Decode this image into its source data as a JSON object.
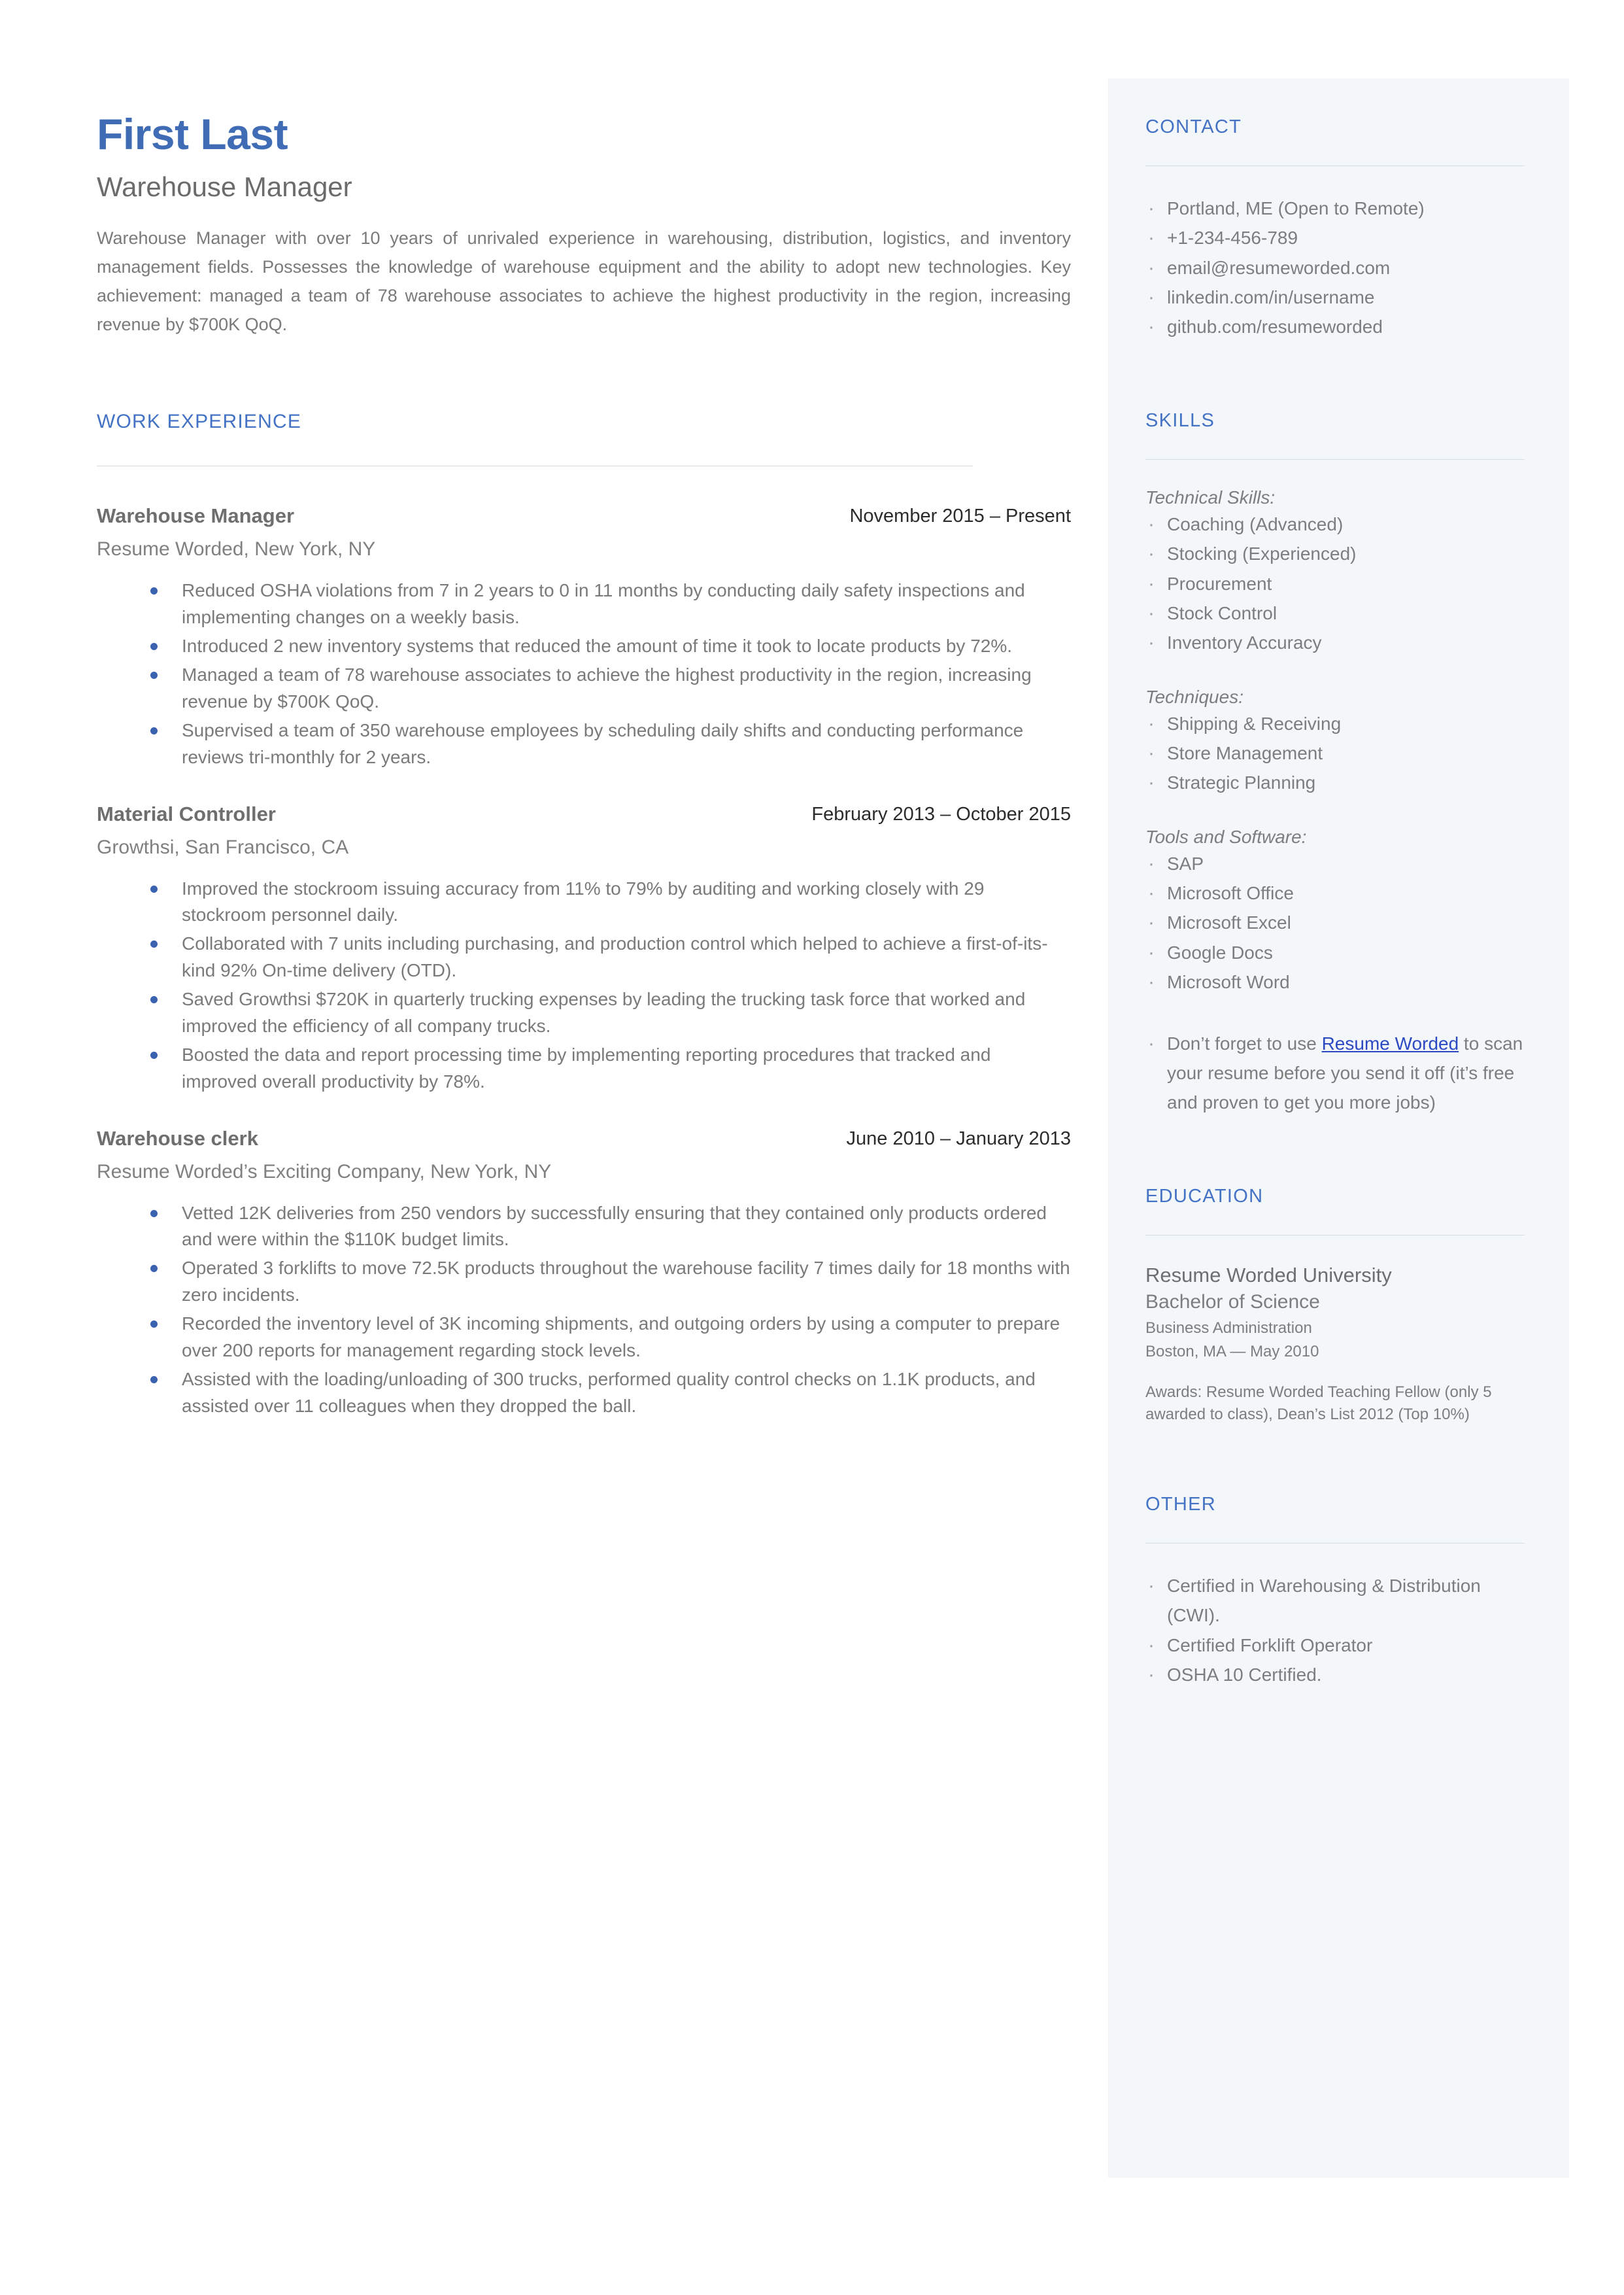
{
  "document": {
    "type": "resume",
    "accent_color": "#4472c4",
    "name_color": "#3f6cb4",
    "sidebar_background": "#f4f7fa",
    "bullet_color": "#3b62b0",
    "link_color": "#2c49c4"
  },
  "header": {
    "name": "First Last",
    "headline": "Warehouse Manager",
    "summary": "Warehouse Manager with over 10 years of unrivaled experience in warehousing, distribution, logistics, and inventory management fields. Possesses the knowledge of warehouse equipment and the ability to adopt new technologies. Key achievement: managed a team of 78 warehouse associates to achieve the highest productivity in the region, increasing revenue by $700K QoQ."
  },
  "work_experience": {
    "section_title": "WORK EXPERIENCE",
    "jobs": [
      {
        "title": "Warehouse Manager",
        "dates": "November 2015 – Present",
        "company": "Resume Worded, New York, NY",
        "bullets": [
          "Reduced OSHA violations from 7 in 2 years to 0 in 11 months by conducting daily safety inspections and implementing changes on a weekly basis.",
          "Introduced 2 new inventory systems that reduced the amount of time it took to locate products by 72%.",
          "Managed a team of 78 warehouse associates to achieve the highest productivity in the region, increasing revenue by $700K QoQ.",
          "Supervised a team of 350 warehouse employees by scheduling daily shifts and conducting performance reviews tri-monthly for 2 years."
        ]
      },
      {
        "title": "Material Controller",
        "dates": "February 2013 – October 2015",
        "company": "Growthsi, San Francisco, CA",
        "bullets": [
          "Improved the stockroom issuing accuracy from 11% to 79% by auditing and working closely with 29 stockroom personnel daily.",
          "Collaborated with 7 units including purchasing, and production control which helped to achieve a first-of-its-kind 92% On-time delivery (OTD).",
          "Saved Growthsi $720K in quarterly trucking expenses by leading the trucking task force that worked and improved the efficiency of all company trucks.",
          "Boosted the data and report processing time by implementing reporting procedures that tracked and improved overall productivity by 78%."
        ]
      },
      {
        "title": "Warehouse clerk",
        "dates": "June 2010 – January 2013",
        "company": "Resume Worded’s Exciting Company, New York, NY",
        "bullets": [
          "Vetted 12K deliveries from 250 vendors by successfully ensuring that they contained only products ordered and were within the $110K budget limits.",
          "Operated 3 forklifts to move 72.5K products throughout the warehouse facility 7 times daily for 18 months with zero incidents.",
          "Recorded the inventory level of 3K incoming shipments, and outgoing orders by using a computer to prepare over 200 reports for management regarding stock levels.",
          "Assisted with the loading/unloading of 300 trucks, performed quality control checks on 1.1K products, and assisted over 11 colleagues when they dropped the ball."
        ]
      }
    ]
  },
  "contact": {
    "section_title": "CONTACT",
    "items": [
      "Portland, ME (Open to Remote)",
      "+1-234-456-789",
      "email@resumeworded.com",
      "linkedin.com/in/username",
      "github.com/resumeworded"
    ]
  },
  "skills": {
    "section_title": "SKILLS",
    "groups": [
      {
        "label": "Technical Skills:",
        "items": [
          "Coaching (Advanced)",
          "Stocking (Experienced)",
          "Procurement",
          "Stock Control",
          "Inventory Accuracy"
        ]
      },
      {
        "label": "Techniques:",
        "items": [
          "Shipping & Receiving",
          "Store Management",
          "Strategic Planning"
        ]
      },
      {
        "label": "Tools and Software:",
        "items": [
          "SAP",
          "Microsoft Office",
          "Microsoft Excel",
          "Google Docs",
          "Microsoft Word"
        ]
      }
    ],
    "note": {
      "before_link": "Don’t forget to use ",
      "link_text": "Resume Worded",
      "after_link": " to scan your resume before you send it off (it’s free and proven to get you more jobs)"
    }
  },
  "education": {
    "section_title": "EDUCATION",
    "school": "Resume Worded University",
    "degree": "Bachelor of Science",
    "field": "Business Administration",
    "place_date": "Boston, MA — May 2010",
    "awards": "Awards: Resume Worded Teaching Fellow (only 5 awarded to class), Dean’s List 2012 (Top 10%)"
  },
  "other": {
    "section_title": "OTHER",
    "items": [
      "Certified in Warehousing & Distribution (CWI).",
      "Certified Forklift Operator",
      "OSHA 10 Certified."
    ]
  }
}
